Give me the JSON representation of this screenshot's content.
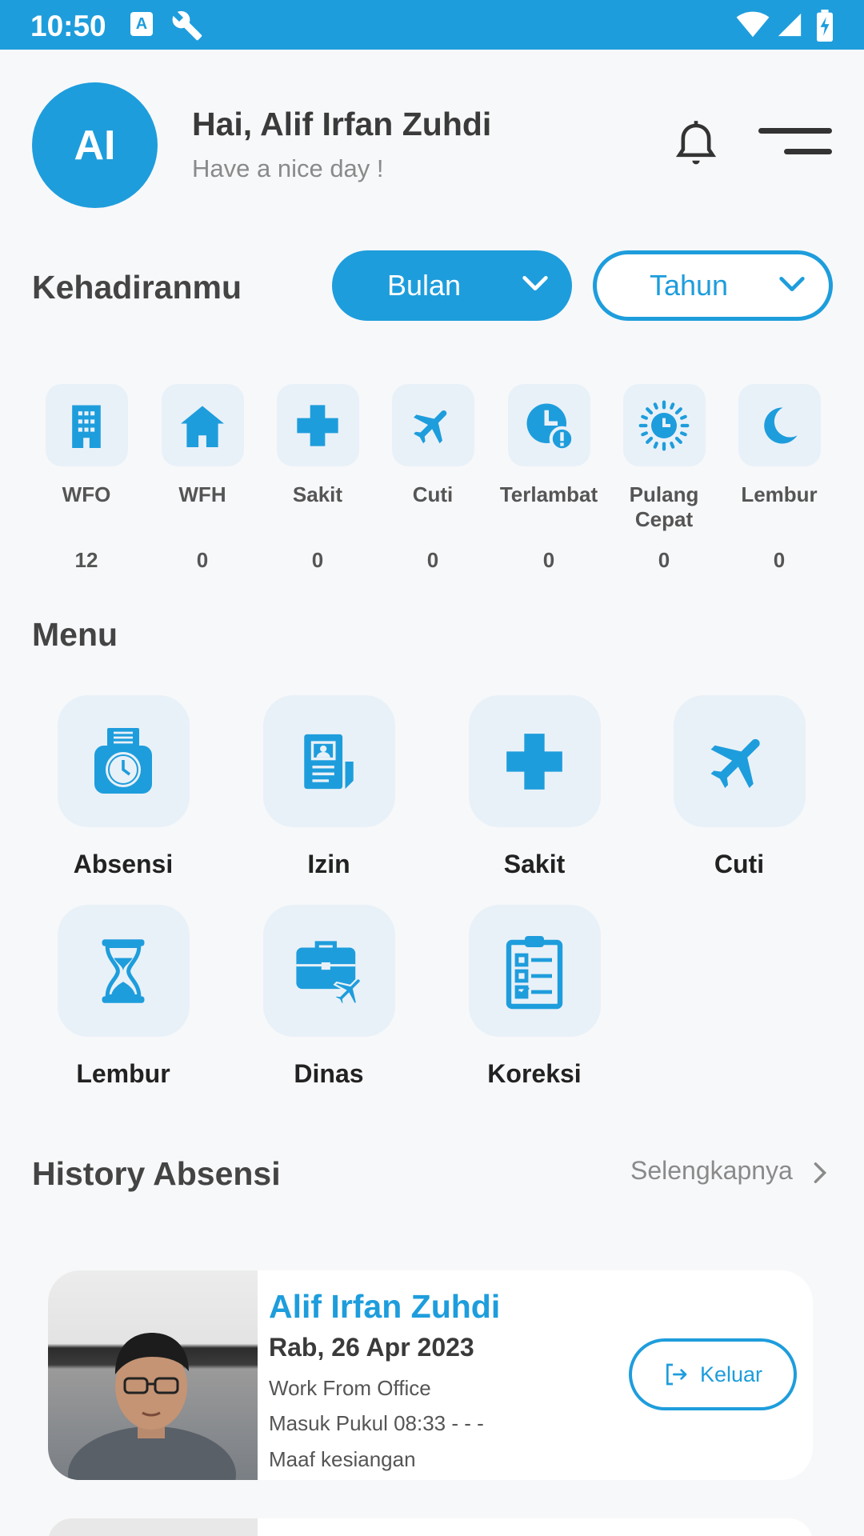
{
  "status_bar": {
    "time": "10:50",
    "notif_badge": "A"
  },
  "header": {
    "avatar_initials": "AI",
    "greeting": "Hai, Alif Irfan Zuhdi",
    "subtitle": "Have a nice day !"
  },
  "attendance": {
    "title": "Kehadiranmu",
    "filter_month": "Bulan",
    "filter_year": "Tahun",
    "stats": [
      {
        "label": "WFO",
        "value": "12",
        "icon": "office-building-icon"
      },
      {
        "label": "WFH",
        "value": "0",
        "icon": "home-icon"
      },
      {
        "label": "Sakit",
        "value": "0",
        "icon": "medical-cross-icon"
      },
      {
        "label": "Cuti",
        "value": "0",
        "icon": "airplane-icon"
      },
      {
        "label": "Terlambat",
        "value": "0",
        "icon": "clock-alert-icon"
      },
      {
        "label": "Pulang Cepat",
        "value": "0",
        "icon": "sun-clock-icon"
      },
      {
        "label": "Lembur",
        "value": "0",
        "icon": "moon-icon"
      }
    ]
  },
  "menu": {
    "title": "Menu",
    "items": [
      {
        "label": "Absensi",
        "icon": "time-clock-icon"
      },
      {
        "label": "Izin",
        "icon": "permit-document-icon"
      },
      {
        "label": "Sakit",
        "icon": "medical-cross-icon"
      },
      {
        "label": "Cuti",
        "icon": "airplane-icon"
      },
      {
        "label": "Lembur",
        "icon": "hourglass-icon"
      },
      {
        "label": "Dinas",
        "icon": "briefcase-travel-icon"
      },
      {
        "label": "Koreksi",
        "icon": "checklist-clipboard-icon"
      }
    ]
  },
  "history": {
    "title": "History Absensi",
    "more_label": "Selengkapnya",
    "entries": [
      {
        "name": "Alif Irfan Zuhdi",
        "date": "Rab, 26 Apr 2023",
        "type": "Work From Office",
        "time": "Masuk Pukul 08:33 - - -",
        "note": "Maaf kesiangan",
        "action": "Keluar"
      }
    ]
  },
  "colors": {
    "accent": "#1e9ddc",
    "icon_bg": "#e9f1f8",
    "background": "#f7f8fa"
  }
}
